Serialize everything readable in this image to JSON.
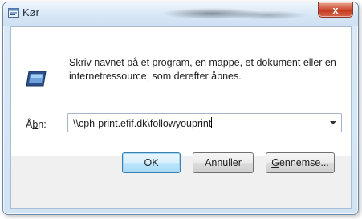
{
  "window": {
    "title": "Kør",
    "close_label": "x"
  },
  "dialog": {
    "description": "Skriv navnet på et program, en mappe, et dokument eller en internetressource, som derefter åbnes.",
    "open_label_prefix": "Å",
    "open_label_accel": "b",
    "open_label_suffix": "n:",
    "combo_value": "\\\\cph-print.efif.dk\\followyouprint"
  },
  "buttons": {
    "ok": "OK",
    "cancel": "Annuller",
    "browse_accel": "G",
    "browse_rest": "ennemse..."
  },
  "icons": {
    "title": "run-icon",
    "app": "run-icon",
    "dropdown": "chevron-down-icon"
  }
}
